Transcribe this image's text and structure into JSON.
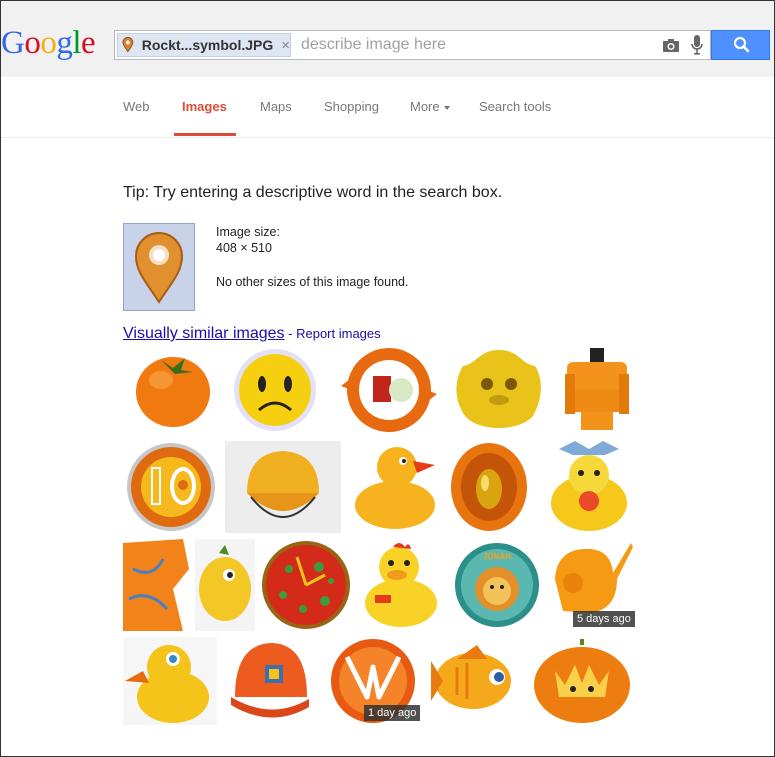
{
  "logo": {
    "letters": [
      "G",
      "o",
      "o",
      "g",
      "l",
      "e"
    ],
    "colors": [
      "#3369e8",
      "#d50f25",
      "#eeb211",
      "#3369e8",
      "#009925",
      "#d50f25"
    ]
  },
  "search": {
    "chip_label": "Rockt...symbol.JPG",
    "chip_close": "×",
    "placeholder": "describe image here",
    "buttons": [
      "camera-icon",
      "mic-icon",
      "search-icon"
    ]
  },
  "nav": {
    "items": [
      {
        "label": "Web"
      },
      {
        "label": "Images",
        "active": true
      },
      {
        "label": "Maps"
      },
      {
        "label": "Shopping"
      },
      {
        "label": "More"
      },
      {
        "label": "Search tools"
      }
    ]
  },
  "tip": "Tip: Try entering a descriptive word in the search box.",
  "image_info": {
    "size_label": "Image size:",
    "size_value": "408 × 510",
    "other_sizes": "No other sizes of this image found."
  },
  "similar": {
    "link": "Visually similar images",
    "separator": " - ",
    "report": "Report images"
  },
  "results": [
    {
      "name": "orange-persimmon"
    },
    {
      "name": "sad-smiley-face"
    },
    {
      "name": "orange-refresh-icon"
    },
    {
      "name": "yellow-flower-face"
    },
    {
      "name": "orange-device"
    },
    {
      "name": "ten-badge"
    },
    {
      "name": "orange-cap"
    },
    {
      "name": "rubber-duck"
    },
    {
      "name": "golden-egg"
    },
    {
      "name": "chick-in-egg"
    },
    {
      "name": "orange-map"
    },
    {
      "name": "yellow-plush"
    },
    {
      "name": "pizza-clock"
    },
    {
      "name": "duck-toy"
    },
    {
      "name": "jonah-lion-badge"
    },
    {
      "name": "elephant-toy",
      "badge": "5 days ago"
    },
    {
      "name": "duck-plush"
    },
    {
      "name": "orange-baseball-cap"
    },
    {
      "name": "orange-ball-logo",
      "badge": "1 day ago"
    },
    {
      "name": "orange-fish"
    },
    {
      "name": "pumpkin-crown"
    }
  ]
}
